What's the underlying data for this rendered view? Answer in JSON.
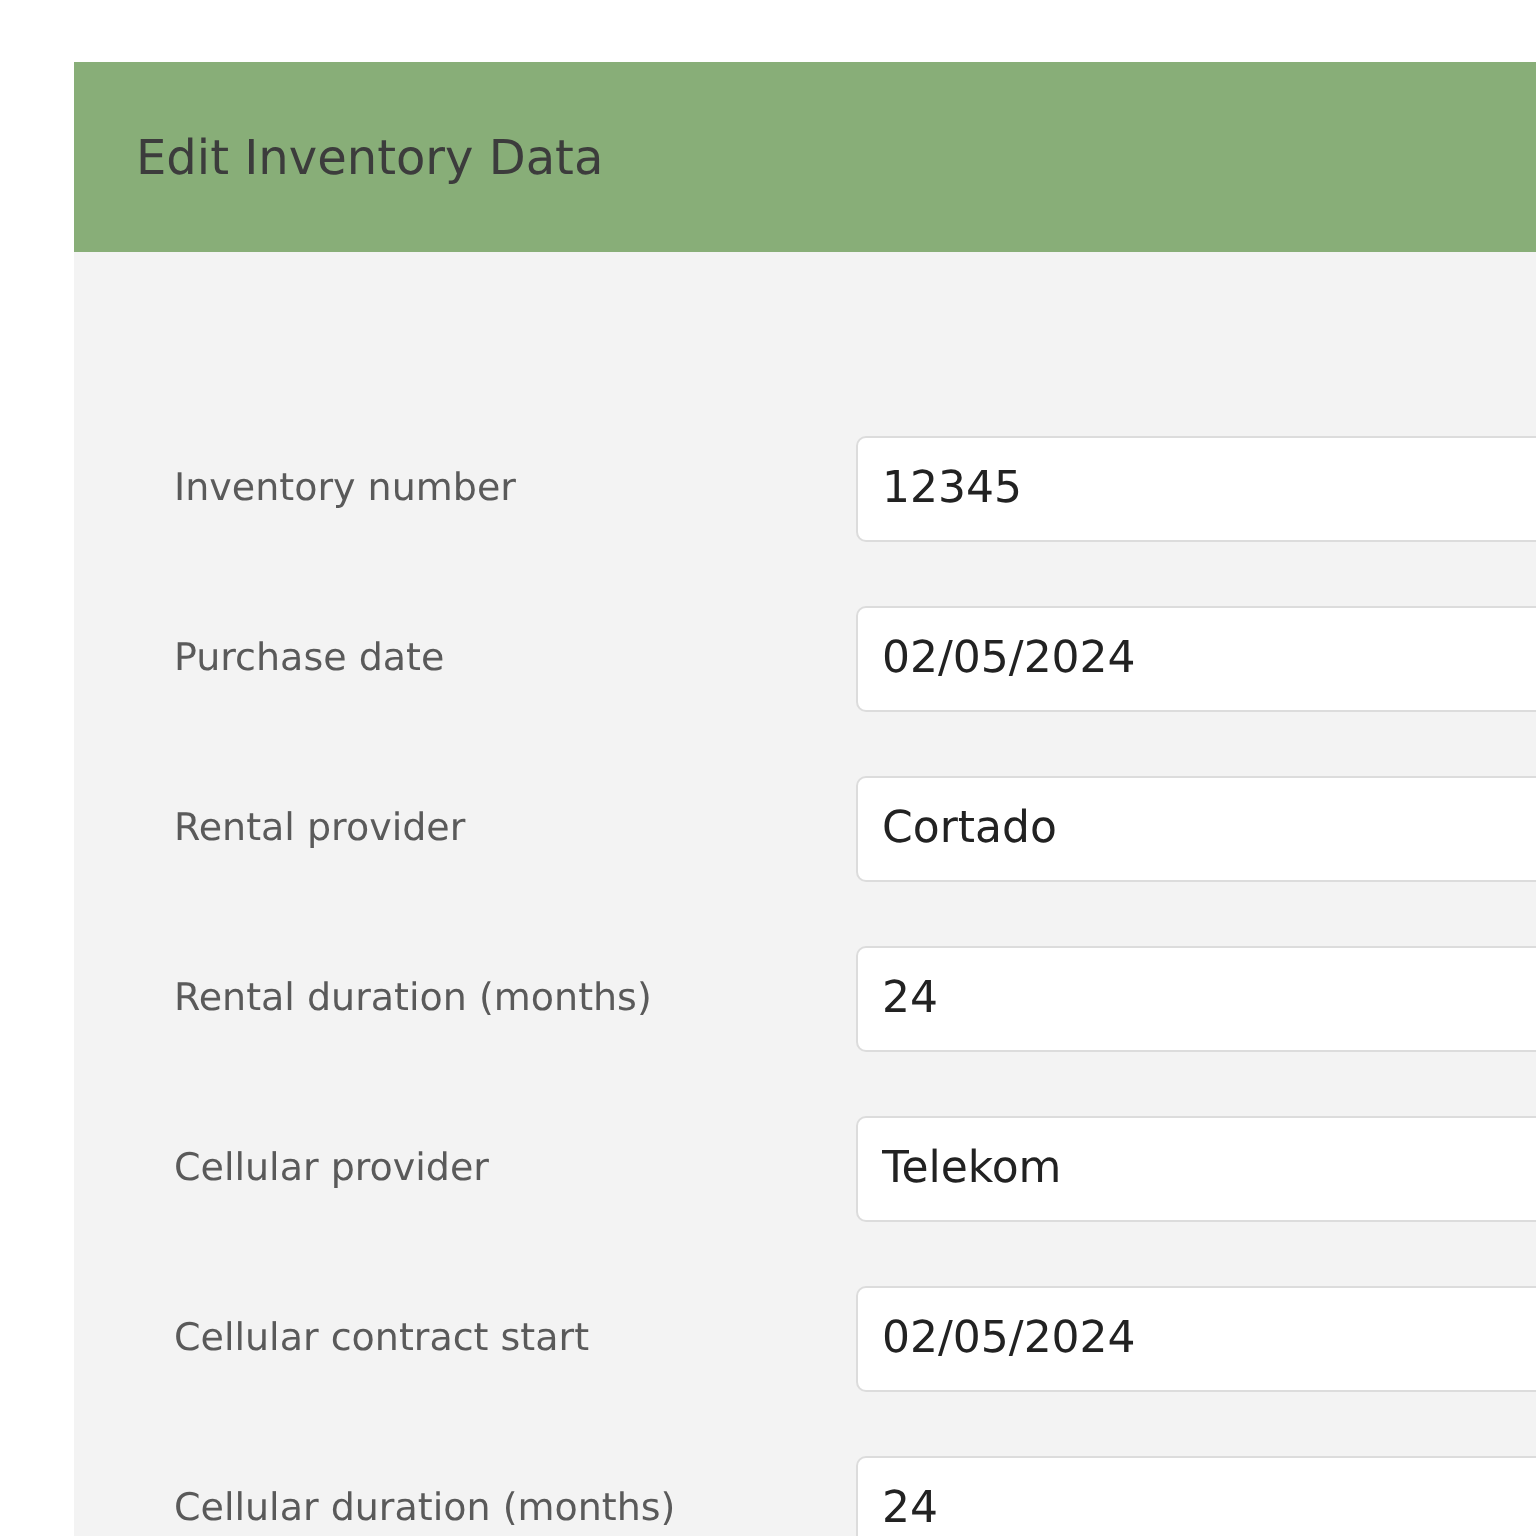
{
  "dialog": {
    "title": "Edit Inventory Data"
  },
  "fields": [
    {
      "label": "Inventory number",
      "value": "12345"
    },
    {
      "label": "Purchase date",
      "value": "02/05/2024"
    },
    {
      "label": "Rental provider",
      "value": "Cortado"
    },
    {
      "label": "Rental duration (months)",
      "value": "24"
    },
    {
      "label": "Cellular provider",
      "value": "Telekom"
    },
    {
      "label": "Cellular contract start",
      "value": "02/05/2024"
    },
    {
      "label": "Cellular duration (months)",
      "value": "24"
    }
  ]
}
